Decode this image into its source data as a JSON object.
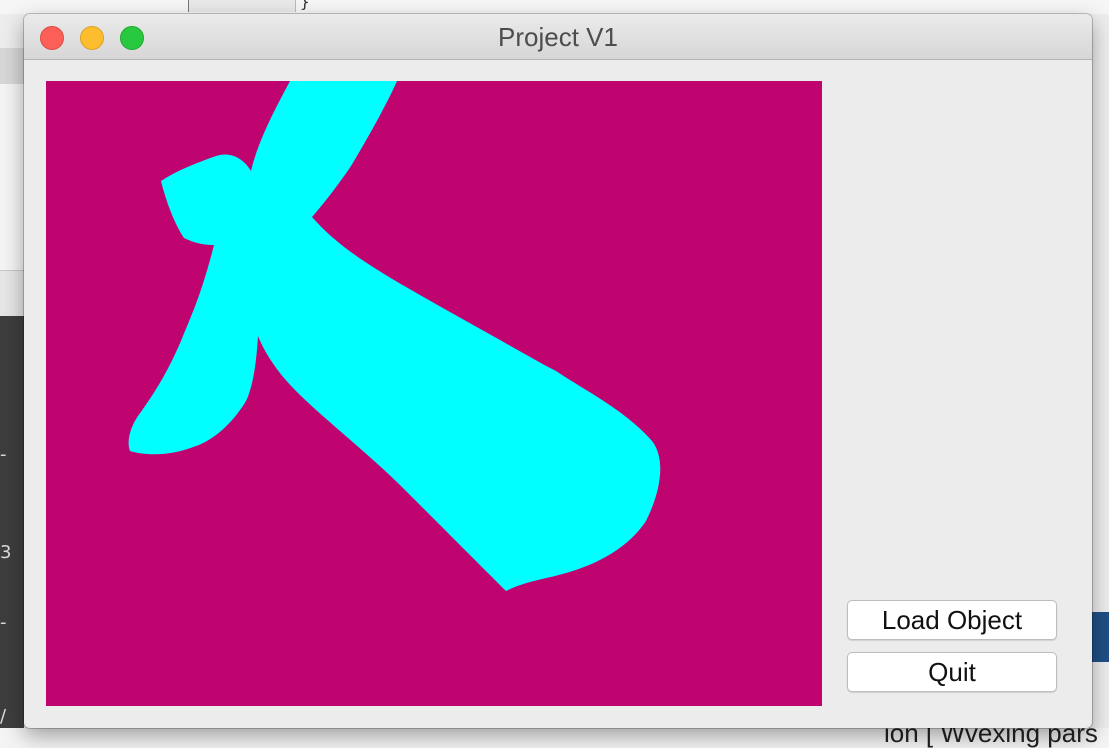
{
  "window": {
    "title": "Project V1"
  },
  "buttons": {
    "load_object": "Load Object",
    "quit": "Quit"
  },
  "canvas": {
    "background_color": "#c0046f",
    "shape_color": "#00ffff"
  },
  "background_app": {
    "brace_text": "}",
    "bottom_text": "ion [ Wvexing pars",
    "left_fragments": [
      "-",
      "3",
      "-",
      "/"
    ]
  },
  "colors": {
    "close": "#fc5f57",
    "minimize": "#fdbd2e",
    "zoom": "#28c840"
  }
}
